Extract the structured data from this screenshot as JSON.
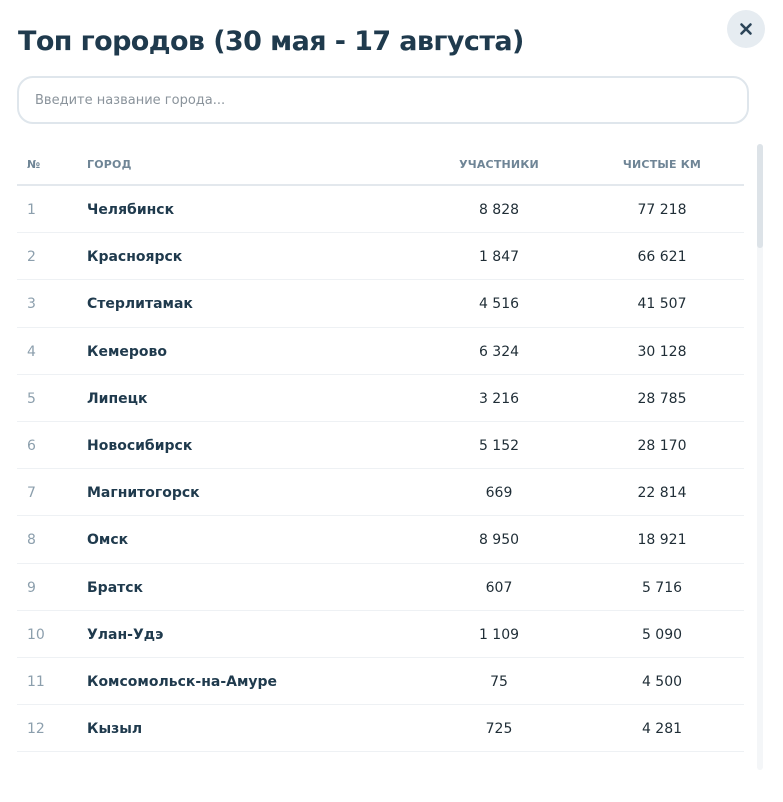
{
  "title": "Топ городов (30 мая - 17 августа)",
  "close_icon": "close-icon",
  "search": {
    "placeholder": "Введите название города...",
    "value": ""
  },
  "table": {
    "headers": {
      "num": "№",
      "city": "ГОРОД",
      "participants": "УЧАСТНИКИ",
      "km": "ЧИСТЫЕ КМ"
    },
    "rows": [
      {
        "num": "1",
        "city": "Челябинск",
        "participants": "8 828",
        "km": "77 218"
      },
      {
        "num": "2",
        "city": "Красноярск",
        "participants": "1 847",
        "km": "66 621"
      },
      {
        "num": "3",
        "city": "Стерлитамак",
        "participants": "4 516",
        "km": "41 507"
      },
      {
        "num": "4",
        "city": "Кемерово",
        "participants": "6 324",
        "km": "30 128"
      },
      {
        "num": "5",
        "city": "Липецк",
        "participants": "3 216",
        "km": "28 785"
      },
      {
        "num": "6",
        "city": "Новосибирск",
        "participants": "5 152",
        "km": "28 170"
      },
      {
        "num": "7",
        "city": "Магнитогорск",
        "participants": "669",
        "km": "22 814"
      },
      {
        "num": "8",
        "city": "Омск",
        "participants": "8 950",
        "km": "18 921"
      },
      {
        "num": "9",
        "city": "Братск",
        "participants": "607",
        "km": "5 716"
      },
      {
        "num": "10",
        "city": "Улан-Удэ",
        "participants": "1 109",
        "km": "5 090"
      },
      {
        "num": "11",
        "city": "Комсомольск-на-Амуре",
        "participants": "75",
        "km": "4 500"
      },
      {
        "num": "12",
        "city": "Кызыл",
        "participants": "725",
        "km": "4 281"
      }
    ]
  },
  "colors": {
    "title": "#1f3a4d",
    "header_text": "#6f8596",
    "row_number": "#8c9fad",
    "close_bg": "#e6ecf1"
  }
}
